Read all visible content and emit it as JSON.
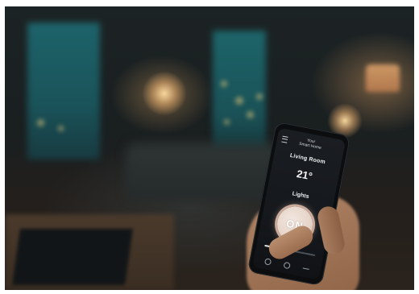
{
  "app": {
    "title_line1": "Your",
    "title_line2": "Smart Home",
    "room_name": "Living Room",
    "temperature": "21°",
    "lights_label": "Lights",
    "lights_state": "ON",
    "brightness_fraction": 0.45
  },
  "icons": {
    "menu": "hamburger-menu-icon",
    "nav_back": "circle-icon",
    "nav_home": "circle-icon",
    "nav_recent": "line-icon"
  },
  "colors": {
    "button_fill": "#e6d4c8",
    "button_ring": "#c9a99a",
    "screen_bg": "#15181c"
  }
}
